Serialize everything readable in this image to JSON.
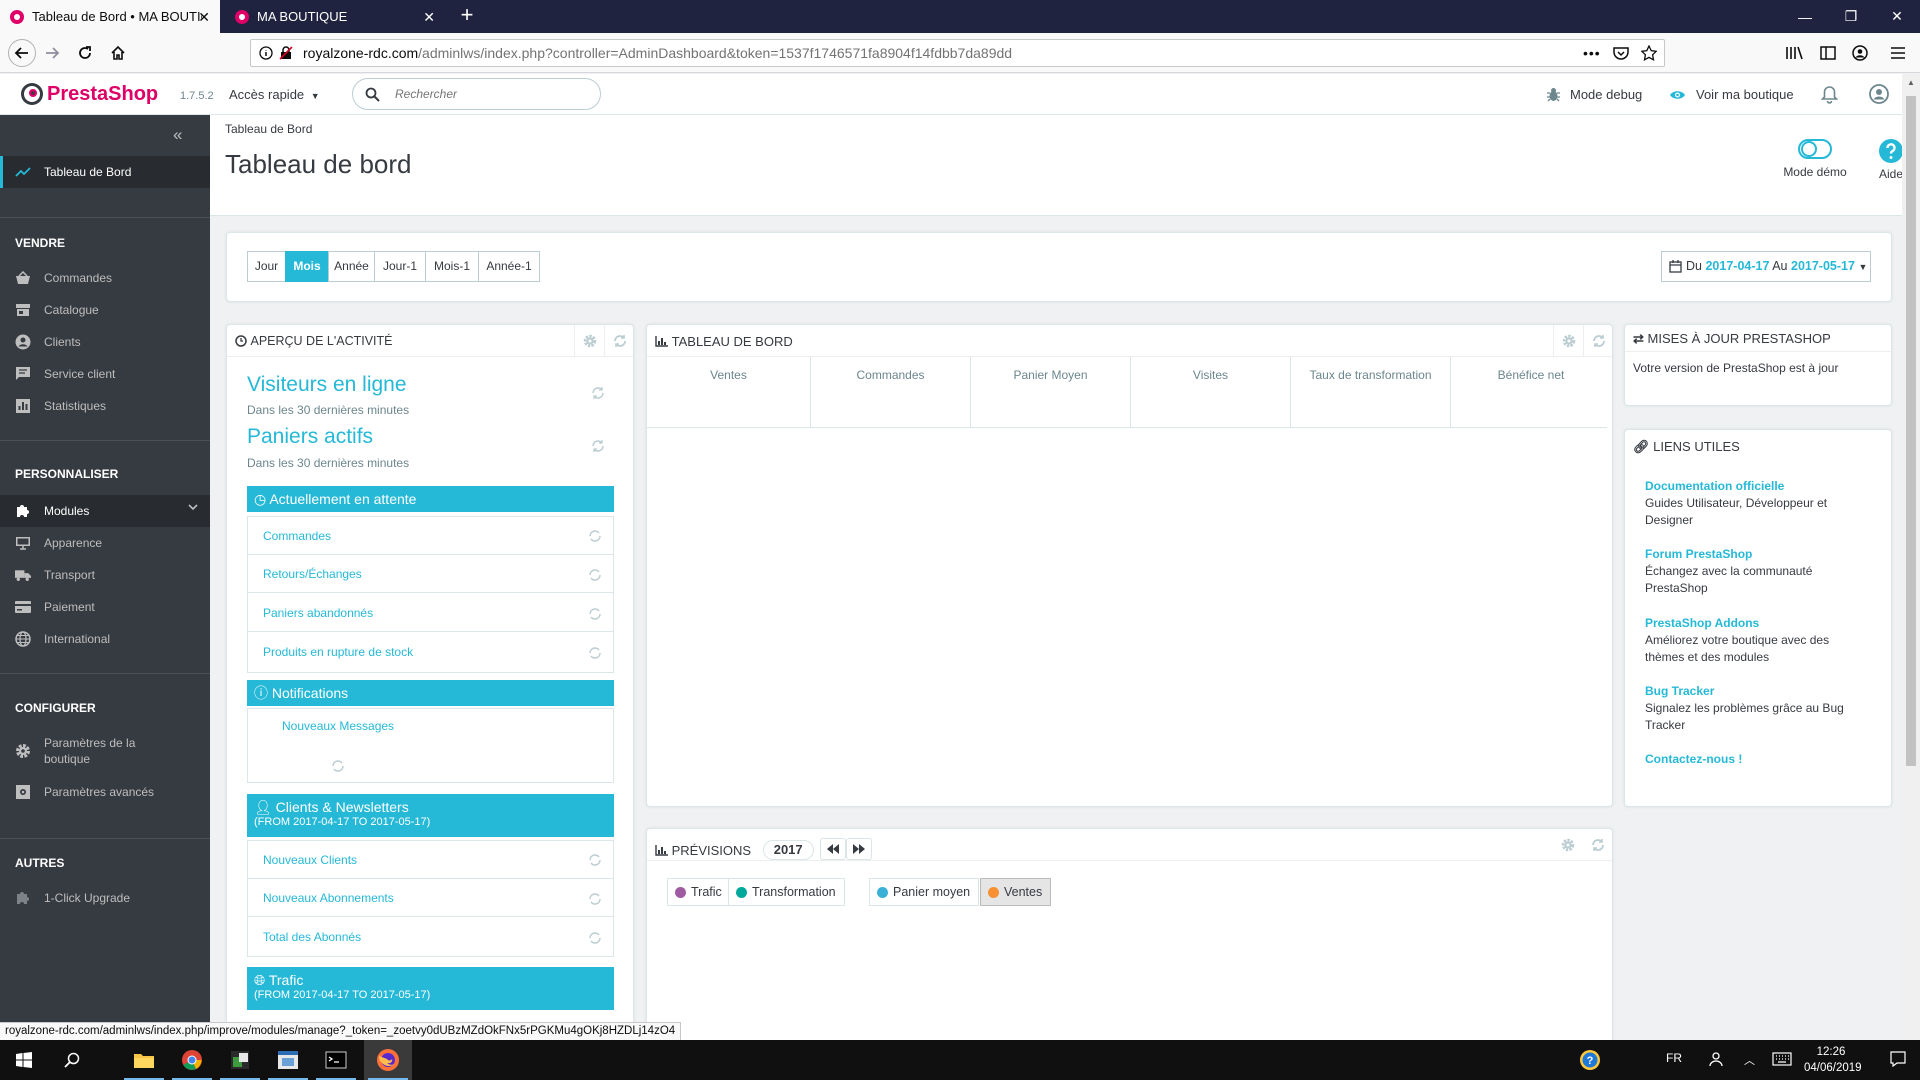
{
  "browser": {
    "tabs": [
      {
        "title": "Tableau de Bord • MA BOUTIQUE",
        "active": true
      },
      {
        "title": "MA BOUTIQUE",
        "active": false
      }
    ],
    "url_host": "royalzone-rdc.com",
    "url_path": "/adminlws/index.php?controller=AdminDashboard&token=1537f1746571fa8904f14fdbb7da89dd",
    "status_url": "royalzone-rdc.com/adminlws/index.php/improve/modules/manage?_token=_zoetvy0dUBzMZdOkFNx5rPGKMu4gOKj8HZDLj14zO4"
  },
  "header": {
    "logo_pre": "Presta",
    "logo_post": "Shop",
    "version": "1.7.5.2",
    "quick_access": "Accès rapide",
    "search_placeholder": "Rechercher",
    "debug": "Mode debug",
    "view_shop": "Voir ma boutique"
  },
  "sidebar": {
    "dashboard": "Tableau de Bord",
    "sections": [
      {
        "title": "VENDRE",
        "items": [
          "Commandes",
          "Catalogue",
          "Clients",
          "Service client",
          "Statistiques"
        ]
      },
      {
        "title": "PERSONNALISER",
        "items": [
          "Modules",
          "Apparence",
          "Transport",
          "Paiement",
          "International"
        ]
      },
      {
        "title": "CONFIGURER",
        "items": [
          "Paramètres de la boutique",
          "Paramètres avancés"
        ]
      },
      {
        "title": "AUTRES",
        "items": [
          "1-Click Upgrade"
        ]
      }
    ]
  },
  "toolbar": {
    "breadcrumb": "Tableau de Bord",
    "title": "Tableau de bord",
    "demo_label": "Mode démo",
    "help_label": "Aide"
  },
  "period": {
    "buttons": [
      "Jour",
      "Mois",
      "Année",
      "Jour-1",
      "Mois-1",
      "Année-1"
    ],
    "active": "Mois",
    "date_prefix": "Du",
    "date_from": "2017-04-17",
    "date_mid": "Au",
    "date_to": "2017-05-17"
  },
  "activity": {
    "title": "APERÇU DE L'ACTIVITÉ",
    "online_visitors": "Visiteurs en ligne",
    "online_sub": "Dans les 30 dernières minutes",
    "active_carts": "Paniers actifs",
    "carts_sub": "Dans les 30 dernières minutes",
    "pending_title": "Actuellement en attente",
    "pending": [
      "Commandes",
      "Retours/Échanges",
      "Paniers abandonnés",
      "Produits en rupture de stock"
    ],
    "notif_title": "Notifications",
    "notif_item": "Nouveaux Messages",
    "clients_title": "Clients & Newsletters",
    "clients_sub": "(FROM 2017-04-17 TO 2017-05-17)",
    "clients": [
      "Nouveaux Clients",
      "Nouveaux Abonnements",
      "Total des Abonnés"
    ],
    "traffic_title": "Trafic",
    "traffic_sub": "(FROM 2017-04-17 TO 2017-05-17)"
  },
  "dashboard": {
    "title": "TABLEAU DE BORD",
    "columns": [
      "Ventes",
      "Commandes",
      "Panier Moyen",
      "Visites",
      "Taux de transformation",
      "Bénéfice net"
    ]
  },
  "forecast": {
    "title": "PRÉVISIONS",
    "year": "2017",
    "legend": [
      {
        "label": "Trafic",
        "color": "#9e5ba1"
      },
      {
        "label": "Transformation",
        "color": "#00a89c"
      },
      {
        "label": "Panier moyen",
        "color": "#3ab0d7"
      },
      {
        "label": "Ventes",
        "color": "#f99031"
      }
    ]
  },
  "updates": {
    "title": "MISES À JOUR PRESTASHOP",
    "text": "Votre version de PrestaShop est à jour"
  },
  "links": {
    "title": "LIENS UTILES",
    "items": [
      {
        "label": "Documentation officielle",
        "desc": "Guides Utilisateur, Développeur et Designer"
      },
      {
        "label": "Forum PrestaShop",
        "desc": "Échangez avec la communauté PrestaShop"
      },
      {
        "label": "PrestaShop Addons",
        "desc": "Améliorez votre boutique avec des thèmes et des modules"
      },
      {
        "label": "Bug Tracker",
        "desc": "Signalez les problèmes grâce au Bug Tracker"
      },
      {
        "label": "Contactez-nous !",
        "desc": ""
      }
    ]
  },
  "taskbar": {
    "lang": "FR",
    "time": "12:26",
    "date": "04/06/2019"
  }
}
